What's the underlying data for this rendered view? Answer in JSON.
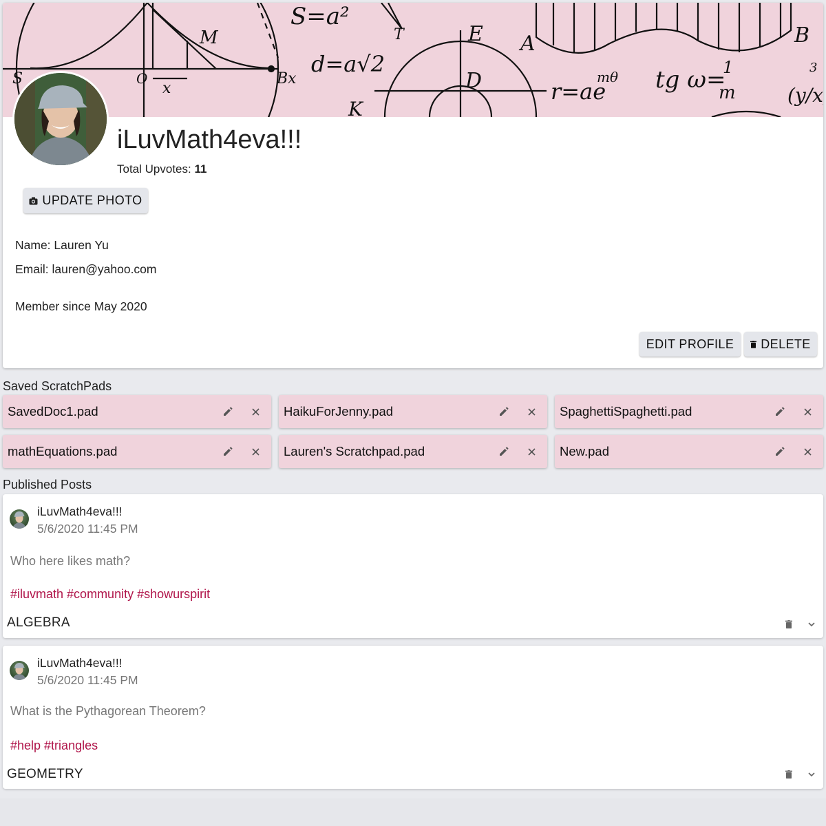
{
  "profile": {
    "username": "iLuvMath4eva!!!",
    "upvotes_label": "Total Upvotes:",
    "upvotes_value": "11",
    "update_photo_label": "UPDATE PHOTO",
    "name_line": "Name: Lauren Yu",
    "email_line": "Email: lauren@yahoo.com",
    "member_since": "Member since May 2020",
    "edit_label": "EDIT PROFILE",
    "delete_label": "DELETE"
  },
  "banner": {
    "formulas": [
      "S=a²",
      "d=a√2",
      "r=ae",
      "mθ",
      "tg ω=",
      "1",
      "m",
      "(y/x)",
      "3",
      "M",
      "T",
      "E",
      "A",
      "B",
      "D",
      "K",
      "S",
      "O",
      "x",
      "Bx"
    ]
  },
  "scratchpads": {
    "title": "Saved ScratchPads",
    "items": [
      {
        "name": "SavedDoc1.pad"
      },
      {
        "name": "HaikuForJenny.pad"
      },
      {
        "name": "SpaghettiSpaghetti.pad"
      },
      {
        "name": "mathEquations.pad"
      },
      {
        "name": "Lauren's Scratchpad.pad"
      },
      {
        "name": "New.pad"
      }
    ]
  },
  "posts": {
    "title": "Published Posts",
    "items": [
      {
        "author": "iLuvMath4eva!!!",
        "date": "5/6/2020 11:45 PM",
        "body": "Who here likes math?",
        "tags": [
          "#iluvmath",
          "#community",
          "#showurspirit"
        ],
        "category": "ALGEBRA"
      },
      {
        "author": "iLuvMath4eva!!!",
        "date": "5/6/2020 11:45 PM",
        "body": "What is the Pythagorean Theorem?",
        "tags": [
          "#help",
          "#triangles"
        ],
        "category": "GEOMETRY"
      }
    ]
  },
  "colors": {
    "accent_pink": "#f0d3dc",
    "tag_color": "#b0154a",
    "page_bg": "#e9eaee"
  },
  "icons": {
    "camera": "camera-icon",
    "trash": "trash-icon",
    "pencil": "pencil-icon",
    "close": "close-icon",
    "chevron": "chevron-down-icon"
  }
}
